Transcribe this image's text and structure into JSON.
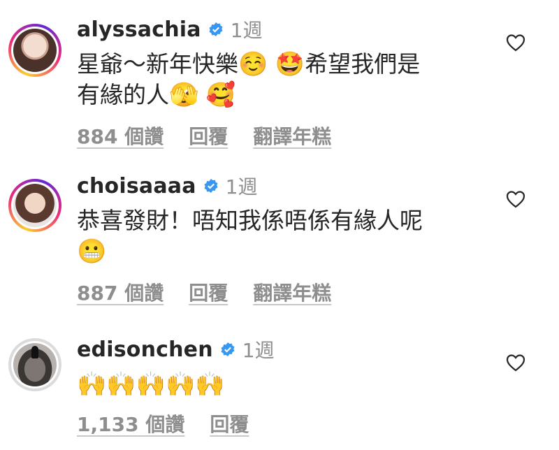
{
  "comments": [
    {
      "username": "alyssachia",
      "time": "1週",
      "text_line1": "星爺～新年快樂",
      "emoji1": "☺️",
      "emoji2": "🤩",
      "text_line1b": "希望我們是",
      "text_line2": "有緣的人",
      "emoji3": "🫣",
      "emoji4": "🥰",
      "likes": "884 個讚",
      "reply": "回覆",
      "translate": "翻譯年糕"
    },
    {
      "username": "choisaaaa",
      "time": "1週",
      "text_line1": "恭喜發財！唔知我係唔係有緣人呢",
      "emoji1": "😬",
      "likes": "887 個讚",
      "reply": "回覆",
      "translate": "翻譯年糕"
    },
    {
      "username": "edisonchen",
      "time": "1週",
      "emojis": "🙌🙌🙌🙌🙌",
      "likes": "1,133 個讚",
      "reply": "回覆"
    }
  ],
  "icons": {
    "verified": "verified-badge-icon",
    "like": "heart-outline-icon"
  },
  "colors": {
    "verified_blue": "#3897f0",
    "text": "#262626",
    "muted": "#8e8e8e"
  }
}
